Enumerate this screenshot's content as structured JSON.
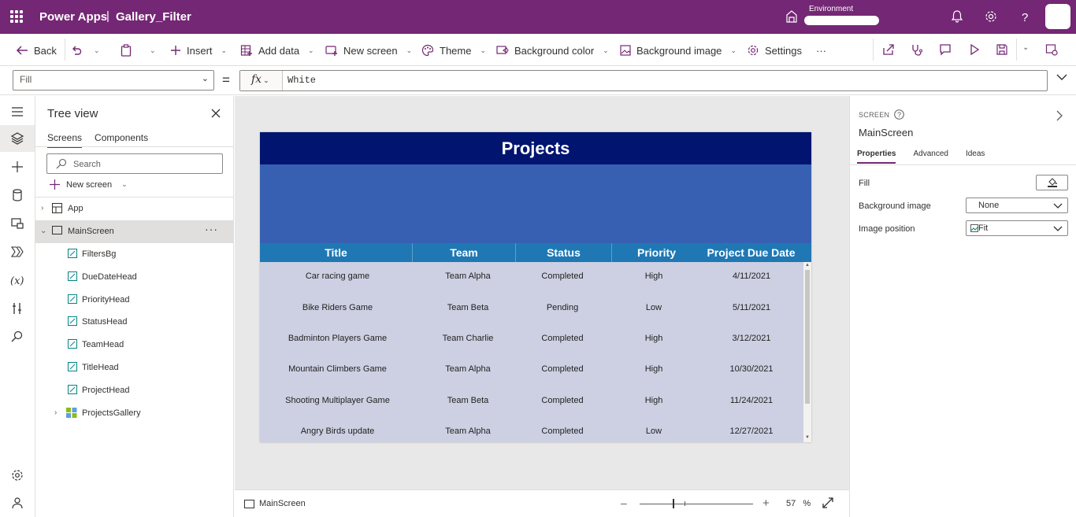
{
  "header": {
    "app_name": "Power Apps",
    "separator": "|",
    "document_name": "Gallery_Filter",
    "environment_label": "Environment",
    "icons": [
      "waffle-icon",
      "environment-icon",
      "bell-icon",
      "gear-icon",
      "help-icon",
      "avatar"
    ]
  },
  "commands": {
    "back": "Back",
    "insert": "Insert",
    "add_data": "Add data",
    "new_screen": "New screen",
    "theme": "Theme",
    "background_color": "Background color",
    "background_image": "Background image",
    "settings": "Settings",
    "more": "···"
  },
  "formula_bar": {
    "property": "Fill",
    "equals": "=",
    "fx_label": "fx",
    "value": "White"
  },
  "tree_view": {
    "title": "Tree view",
    "tabs": [
      "Screens",
      "Components"
    ],
    "search_placeholder": "Search",
    "new_screen": "New screen",
    "nodes": {
      "app": "App",
      "main_screen": "MainScreen",
      "children": [
        "FiltersBg",
        "DueDateHead",
        "PriorityHead",
        "StatusHead",
        "TeamHead",
        "TitleHead",
        "ProjectHead",
        "ProjectsGallery"
      ]
    }
  },
  "canvas": {
    "title": "Projects",
    "columns": [
      "Title",
      "Team",
      "Status",
      "Priority",
      "Project Due Date"
    ],
    "rows": [
      [
        "Car racing game",
        "Team Alpha",
        "Completed",
        "High",
        "4/11/2021"
      ],
      [
        "Bike Riders Game",
        "Team Beta",
        "Pending",
        "Low",
        "5/11/2021"
      ],
      [
        "Badminton Players Game",
        "Team Charlie",
        "Completed",
        "High",
        "3/12/2021"
      ],
      [
        "Mountain Climbers Game",
        "Team Alpha",
        "Completed",
        "High",
        "10/30/2021"
      ],
      [
        "Shooting Multiplayer Game",
        "Team Beta",
        "Completed",
        "High",
        "11/24/2021"
      ],
      [
        "Angry Birds update",
        "Team Alpha",
        "Completed",
        "Low",
        "12/27/2021"
      ]
    ],
    "colors": {
      "title_bar": "#001470",
      "filters_bg": "#3860b2",
      "column_head": "#1f78b4",
      "gallery_bg": "#ccd0e2"
    }
  },
  "status_bar": {
    "screen_name": "MainScreen",
    "zoom_value": "57",
    "zoom_unit": "%"
  },
  "properties_pane": {
    "kind": "SCREEN",
    "screen_name": "MainScreen",
    "tabs": [
      "Properties",
      "Advanced",
      "Ideas"
    ],
    "fill_label": "Fill",
    "background_image_label": "Background image",
    "background_image_value": "None",
    "image_position_label": "Image position",
    "image_position_value": "Fit"
  },
  "brand_color": "#742774"
}
